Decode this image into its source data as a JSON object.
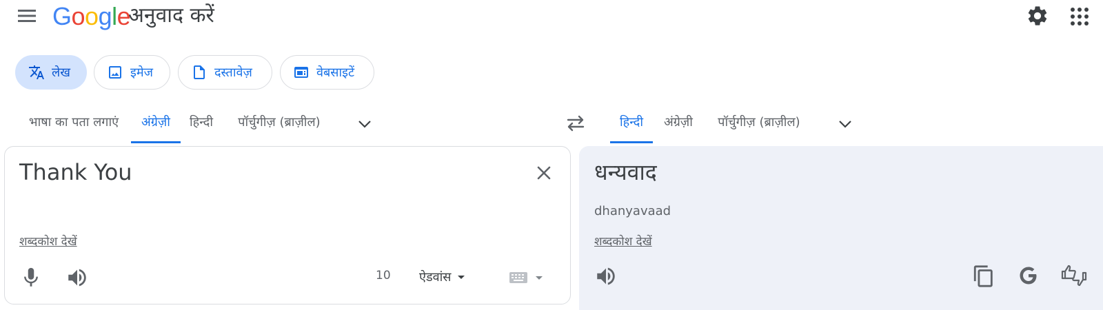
{
  "header": {
    "logo_letters": [
      {
        "ch": "G",
        "color": "#4285F4"
      },
      {
        "ch": "o",
        "color": "#EA4335"
      },
      {
        "ch": "o",
        "color": "#FBBC05"
      },
      {
        "ch": "g",
        "color": "#4285F4"
      },
      {
        "ch": "l",
        "color": "#34A853"
      },
      {
        "ch": "e",
        "color": "#EA4335"
      }
    ],
    "title": "अनुवाद करें",
    "icons": {
      "menu": "menu-icon",
      "settings": "gear-icon",
      "apps": "apps-grid-icon"
    }
  },
  "modes": [
    {
      "label": "लेख",
      "icon": "translate-icon",
      "active": true
    },
    {
      "label": "इमेज",
      "icon": "image-icon",
      "active": false
    },
    {
      "label": "दस्तावेज़",
      "icon": "document-icon",
      "active": false
    },
    {
      "label": "वेबसाइटें",
      "icon": "website-icon",
      "active": false
    }
  ],
  "source_langs": [
    {
      "label": "भाषा का पता लगाएं",
      "active": false
    },
    {
      "label": "अंग्रेज़ी",
      "active": true
    },
    {
      "label": "हिन्दी",
      "active": false
    },
    {
      "label": "पॉर्चुगीज़ (ब्राज़ील)",
      "active": false
    }
  ],
  "target_langs": [
    {
      "label": "हिन्दी",
      "active": true
    },
    {
      "label": "अंग्रेज़ी",
      "active": false
    },
    {
      "label": "पॉर्चुगीज़ (ब्राज़ील)",
      "active": false
    }
  ],
  "source": {
    "text": "Thank You",
    "dictionary_link": "शब्दकोश देखें",
    "char_count": "10",
    "advanced_label": "ऐडवांस"
  },
  "target": {
    "text": "धन्यवाद",
    "transliteration": "dhanyavaad",
    "dictionary_link": "शब्दकोश देखें"
  },
  "colors": {
    "accent": "#1a73e8",
    "active_chip_bg": "#d3e3fd",
    "target_panel_bg": "#eef1f8",
    "icon_gray": "#5f6368"
  }
}
